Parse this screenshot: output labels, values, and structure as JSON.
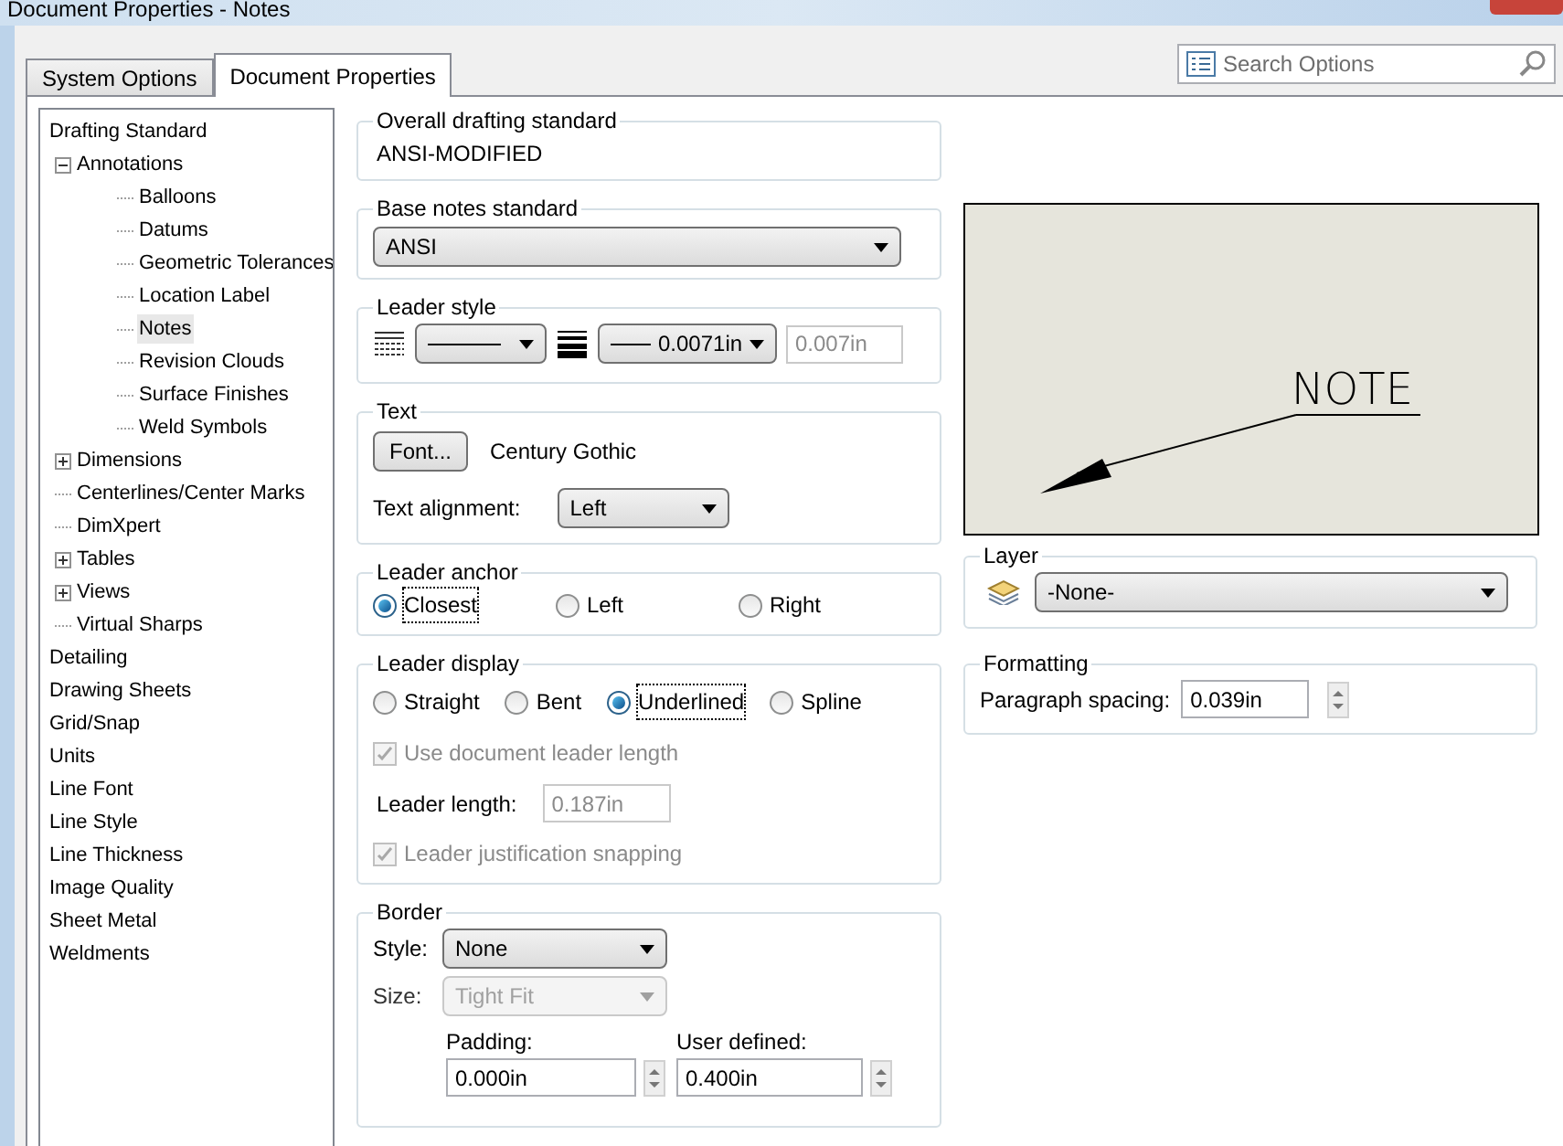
{
  "window": {
    "title": "Document Properties - Notes"
  },
  "tabs": [
    {
      "label": "System Options",
      "selected": false
    },
    {
      "label": "Document Properties",
      "selected": true
    }
  ],
  "search": {
    "placeholder": "Search Options"
  },
  "tree": [
    {
      "label": "Drafting Standard",
      "selected": false,
      "children": [
        {
          "label": "Annotations",
          "selected": false,
          "expanded": true,
          "children": [
            {
              "label": "Balloons",
              "selected": false
            },
            {
              "label": "Datums",
              "selected": false
            },
            {
              "label": "Geometric Tolerances",
              "selected": false
            },
            {
              "label": "Location Label",
              "selected": false
            },
            {
              "label": "Notes",
              "selected": true
            },
            {
              "label": "Revision Clouds",
              "selected": false
            },
            {
              "label": "Surface Finishes",
              "selected": false
            },
            {
              "label": "Weld Symbols",
              "selected": false
            }
          ]
        },
        {
          "label": "Dimensions",
          "selected": false,
          "expanded": false
        },
        {
          "label": "Centerlines/Center Marks",
          "selected": false
        },
        {
          "label": "DimXpert",
          "selected": false
        },
        {
          "label": "Tables",
          "selected": false,
          "expanded": false
        },
        {
          "label": "Views",
          "selected": false,
          "expanded": false
        },
        {
          "label": "Virtual Sharps",
          "selected": false
        }
      ]
    },
    {
      "label": "Detailing",
      "selected": false
    },
    {
      "label": "Drawing Sheets",
      "selected": false
    },
    {
      "label": "Grid/Snap",
      "selected": false
    },
    {
      "label": "Units",
      "selected": false
    },
    {
      "label": "Line Font",
      "selected": false
    },
    {
      "label": "Line Style",
      "selected": false
    },
    {
      "label": "Line Thickness",
      "selected": false
    },
    {
      "label": "Image Quality",
      "selected": false
    },
    {
      "label": "Sheet Metal",
      "selected": false
    },
    {
      "label": "Weldments",
      "selected": false
    }
  ],
  "overall": {
    "title": "Overall drafting standard",
    "value": "ANSI-MODIFIED"
  },
  "base_notes": {
    "title": "Base notes standard",
    "value": "ANSI"
  },
  "leader_style": {
    "title": "Leader style",
    "thickness": "0.0071in",
    "custom_thickness": "0.007in",
    "custom_disabled": true
  },
  "text": {
    "title": "Text",
    "font_button": "Font...",
    "font_name": "Century Gothic",
    "alignment_label": "Text alignment:",
    "alignment": "Left"
  },
  "leader_anchor": {
    "title": "Leader anchor",
    "options": [
      {
        "label": "Closest",
        "selected": true
      },
      {
        "label": "Left",
        "selected": false
      },
      {
        "label": "Right",
        "selected": false
      }
    ]
  },
  "leader_display": {
    "title": "Leader display",
    "options": [
      {
        "label": "Straight",
        "selected": false
      },
      {
        "label": "Bent",
        "selected": false
      },
      {
        "label": "Underlined",
        "selected": true
      },
      {
        "label": "Spline",
        "selected": false
      }
    ],
    "use_document_length": {
      "label": "Use document leader length",
      "checked": true,
      "disabled": true
    },
    "leader_length": {
      "label": "Leader length:",
      "value": "0.187in",
      "disabled": true
    },
    "snapping": {
      "label": "Leader justification snapping",
      "checked": true,
      "disabled": true
    }
  },
  "border": {
    "title": "Border",
    "style_label": "Style:",
    "style": "None",
    "size_label": "Size:",
    "size": "Tight Fit",
    "size_disabled": true,
    "padding_label": "Padding:",
    "padding": "0.000in",
    "user_defined_label": "User defined:",
    "user_defined": "0.400in"
  },
  "preview": {
    "note": "NOTE"
  },
  "layer": {
    "title": "Layer",
    "value": "-None-"
  },
  "formatting": {
    "title": "Formatting",
    "label": "Paragraph spacing:",
    "value": "0.039in"
  }
}
